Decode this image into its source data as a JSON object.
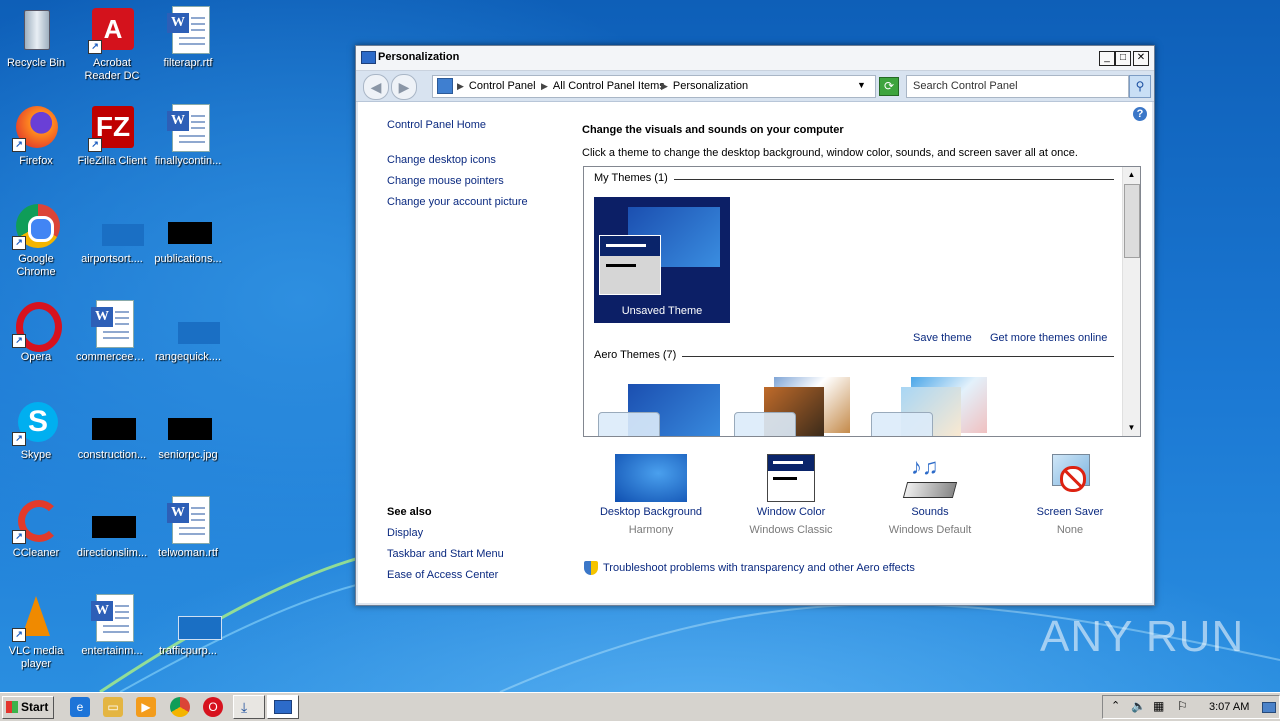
{
  "desktop": {
    "icons": [
      {
        "label": "Recycle Bin"
      },
      {
        "label": "Acrobat Reader DC"
      },
      {
        "label": "filterapr.rtf"
      },
      {
        "label": "Firefox"
      },
      {
        "label": "FileZilla Client"
      },
      {
        "label": "finallycontin..."
      },
      {
        "label": "Google Chrome"
      },
      {
        "label": "airportsort...."
      },
      {
        "label": "publications..."
      },
      {
        "label": "Opera"
      },
      {
        "label": "commerceec..."
      },
      {
        "label": "rangequick...."
      },
      {
        "label": "Skype"
      },
      {
        "label": "construction..."
      },
      {
        "label": "seniorpc.jpg"
      },
      {
        "label": "CCleaner"
      },
      {
        "label": "directionslim..."
      },
      {
        "label": "telwoman.rtf"
      },
      {
        "label": "VLC media player"
      },
      {
        "label": "entertainm..."
      },
      {
        "label": "trafficpurp..."
      }
    ]
  },
  "window": {
    "title": "Personalization",
    "breadcrumb": [
      "Control Panel",
      "All Control Panel Items",
      "Personalization"
    ],
    "search_placeholder": "Search Control Panel",
    "sidebar": {
      "home": "Control Panel Home",
      "links": [
        "Change desktop icons",
        "Change mouse pointers",
        "Change your account picture"
      ],
      "see_also_title": "See also",
      "see_also": [
        "Display",
        "Taskbar and Start Menu",
        "Ease of Access Center"
      ]
    },
    "heading": "Change the visuals and sounds on your computer",
    "subheading": "Click a theme to change the desktop background, window color, sounds, and screen saver all at once.",
    "my_themes_label": "My Themes (1)",
    "unsaved_theme_label": "Unsaved Theme",
    "save_theme": "Save theme",
    "get_more_themes": "Get more themes online",
    "aero_themes_label": "Aero Themes (7)",
    "tools": [
      {
        "label": "Desktop Background",
        "value": "Harmony"
      },
      {
        "label": "Window Color",
        "value": "Windows Classic"
      },
      {
        "label": "Sounds",
        "value": "Windows Default"
      },
      {
        "label": "Screen Saver",
        "value": "None"
      }
    ],
    "troubleshoot": "Troubleshoot problems with transparency and other Aero effects"
  },
  "taskbar": {
    "start_label": "Start",
    "clock": "3:07 AM"
  },
  "watermark": "ANY RUN"
}
